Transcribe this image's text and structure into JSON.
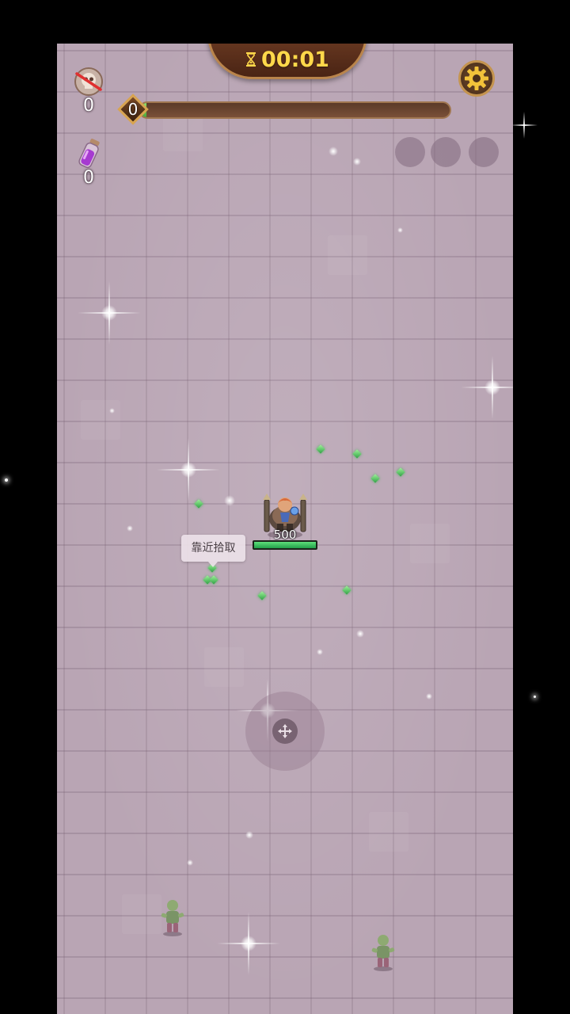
{
  "hud": {
    "timer": "00:01",
    "kill_count": "0",
    "potion_count": "0",
    "level": "0",
    "xp_progress": 0.02,
    "skill_slots": 3
  },
  "hero": {
    "hp_text": "500",
    "hp_fraction": 1.0
  },
  "hint": {
    "pickup_label": "靠近拾取"
  },
  "icons": {
    "timer": "hourglass-icon",
    "settings": "gear-icon",
    "kills": "crossed-skull-icon",
    "potion": "purple-potion-icon",
    "joystick": "move-arrows-icon"
  },
  "colors": {
    "timer_text": "#ffd84a",
    "floor": "#b9a5b4",
    "hp_bar": "#22a04a",
    "gem": "#3fc058",
    "frame_gold": "#c4944f"
  }
}
